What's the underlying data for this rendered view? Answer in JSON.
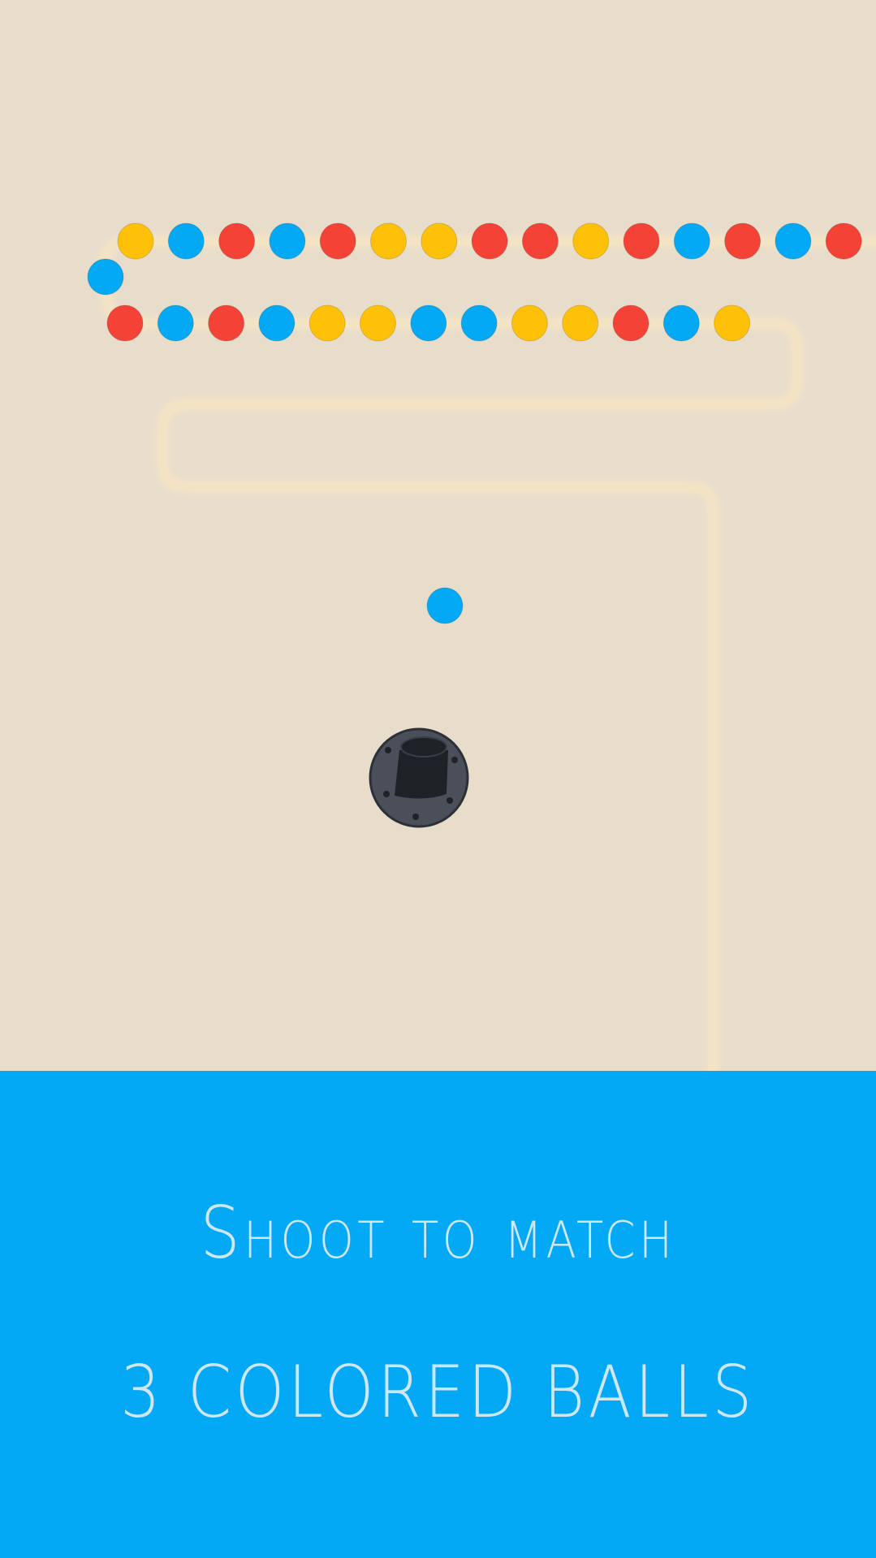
{
  "colors": {
    "board": "#e8ddcb",
    "track_glow": "#f5e4c4",
    "red": "#f44336",
    "blue": "#03a9f4",
    "yellow": "#ffc107",
    "banner": "#03a9f4",
    "caption": "#cfe6f5",
    "cannon_base": "#4a4f5a",
    "cannon_barrel": "#1e2126"
  },
  "chain": {
    "top_row": [
      "yellow",
      "blue",
      "red",
      "blue",
      "red",
      "yellow",
      "yellow",
      "red",
      "red",
      "yellow",
      "red",
      "blue",
      "red",
      "blue",
      "red"
    ],
    "turn_ball": "blue",
    "bottom_row": [
      "red",
      "blue",
      "red",
      "blue",
      "yellow",
      "yellow",
      "blue",
      "blue",
      "yellow",
      "yellow",
      "red",
      "blue",
      "yellow"
    ]
  },
  "shot_ball": "blue",
  "icons": {
    "cannon": "cannon-icon"
  },
  "caption": {
    "line1": "Shoot to match",
    "line2": "3 COLORED BALLS"
  }
}
